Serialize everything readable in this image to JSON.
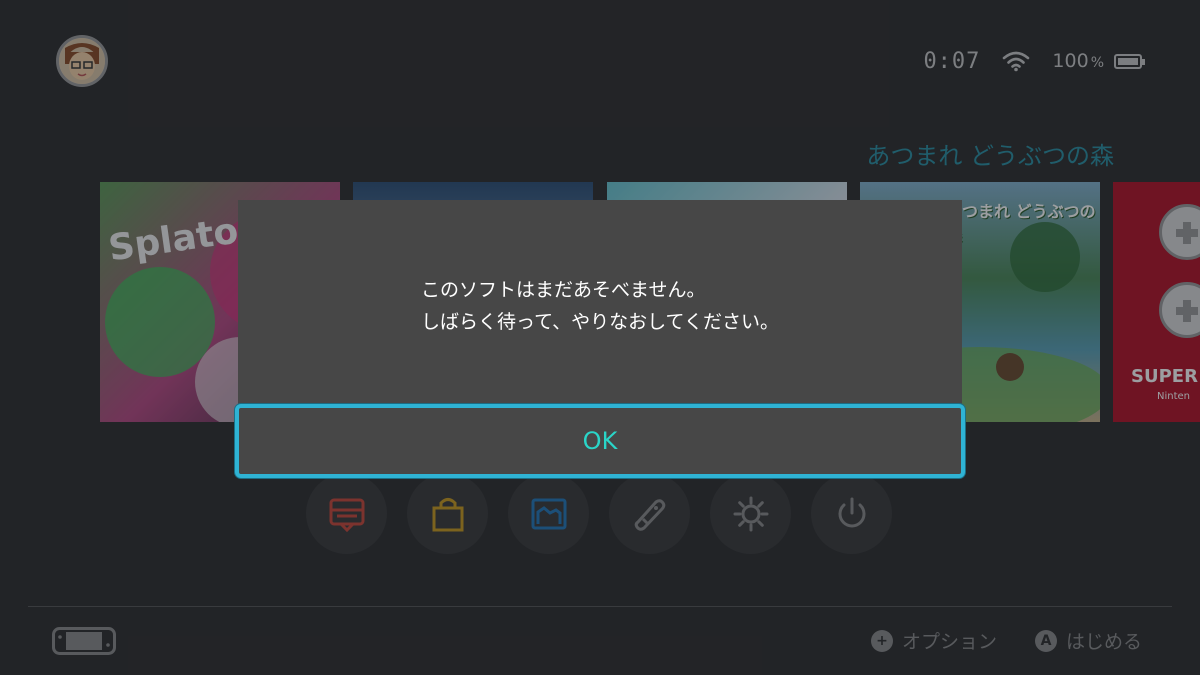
{
  "status": {
    "time": "0:07",
    "battery": "100",
    "battery_unit": "%"
  },
  "selected_game_title": "あつまれ どうぶつの森",
  "tiles": [
    {
      "caption": "Splatoon"
    },
    {
      "caption": ""
    },
    {
      "caption": ""
    },
    {
      "caption": "あつまれ どうぶつの森"
    },
    {
      "caption": "SUPER",
      "sub": "Ninten"
    }
  ],
  "icons": [
    "news-icon",
    "shop-icon",
    "album-icon",
    "controllers-icon",
    "settings-icon",
    "power-icon"
  ],
  "dialog": {
    "line1": "このソフトはまだあそべません。",
    "line2": "しばらく待って、やりなおしてください。",
    "ok_label": "OK"
  },
  "footer": {
    "options_button": "+",
    "options_label": "オプション",
    "start_button": "A",
    "start_label": "はじめる"
  },
  "colors": {
    "accent_cyan": "#2ad5c8",
    "focus_border": "#2fb3d4",
    "title_blue": "#2a8fa3"
  }
}
